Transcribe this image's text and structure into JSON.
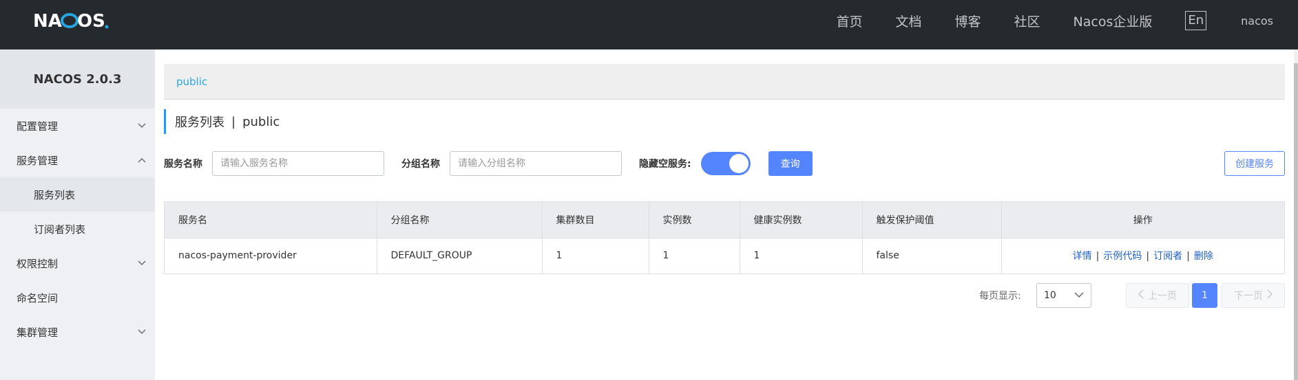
{
  "header": {
    "logo_text": "NACOS.",
    "nav": [
      "首页",
      "文档",
      "博客",
      "社区",
      "Nacos企业版"
    ],
    "lang": "En",
    "user": "nacos"
  },
  "sidebar": {
    "title": "NACOS 2.0.3",
    "items": [
      {
        "label": "配置管理",
        "chevron": "down"
      },
      {
        "label": "服务管理",
        "chevron": "up"
      },
      {
        "label": "服务列表",
        "sub": true,
        "active": true
      },
      {
        "label": "订阅者列表",
        "sub": true
      },
      {
        "label": "权限控制",
        "chevron": "down"
      },
      {
        "label": "命名空间"
      },
      {
        "label": "集群管理",
        "chevron": "down"
      }
    ]
  },
  "namespace": {
    "current": "public"
  },
  "page": {
    "title": "服务列表",
    "separator": "|",
    "namespace": "public"
  },
  "filters": {
    "service_name_label": "服务名称",
    "service_name_placeholder": "请输入服务名称",
    "service_name_value": "",
    "group_name_label": "分组名称",
    "group_name_placeholder": "请输入分组名称",
    "group_name_value": "",
    "hide_empty_label": "隐藏空服务:",
    "hide_empty_on": true,
    "query_button": "查询",
    "create_button": "创建服务"
  },
  "table": {
    "columns": [
      "服务名",
      "分组名称",
      "集群数目",
      "实例数",
      "健康实例数",
      "触发保护阈值",
      "操作"
    ],
    "rows": [
      {
        "service": "nacos-payment-provider",
        "group": "DEFAULT_GROUP",
        "clusters": "1",
        "instances": "1",
        "healthy": "1",
        "threshold": "false",
        "ops": [
          "详情",
          "示例代码",
          "订阅者",
          "删除"
        ]
      }
    ]
  },
  "pagination": {
    "page_size_label": "每页显示:",
    "page_size": "10",
    "prev": "上一页",
    "next": "下一页",
    "current_page": "1"
  },
  "colors": {
    "topbar": "#252a2f",
    "primary": "#5584ff",
    "accent_link": "#29a6e2",
    "sidebar_bg": "#eef0f4"
  }
}
